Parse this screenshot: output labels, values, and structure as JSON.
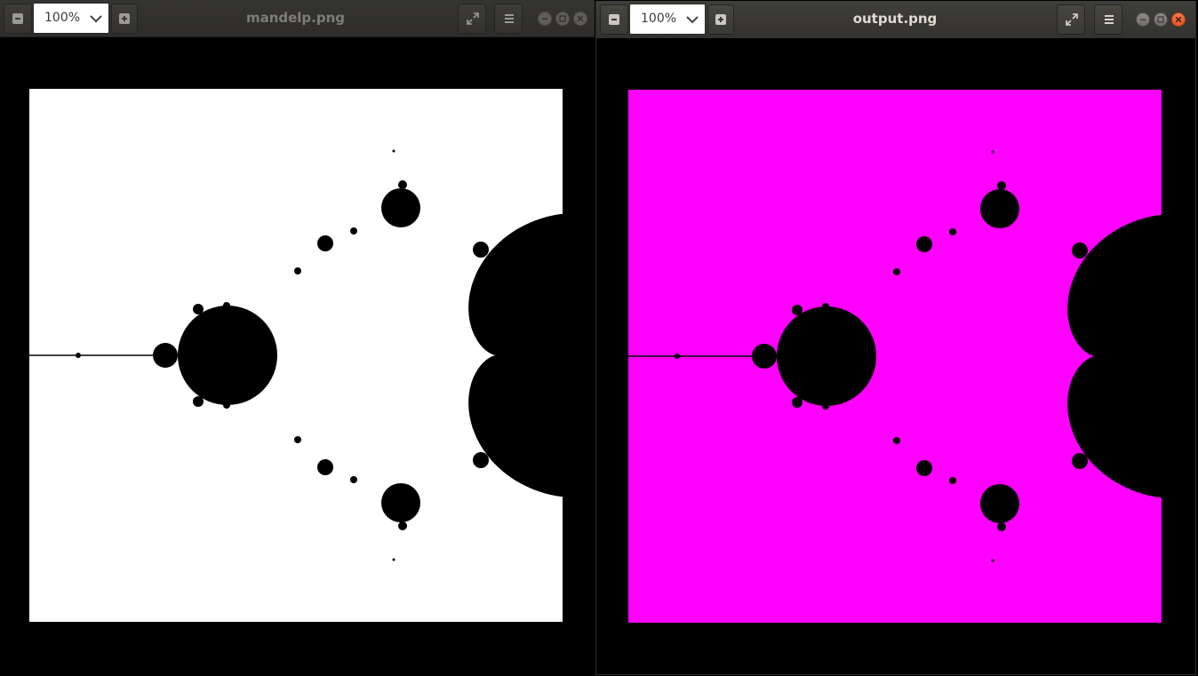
{
  "windows": [
    {
      "title": "mandelp.png",
      "zoom": "100%",
      "background_color": "#ffffff",
      "focused": false
    },
    {
      "title": "output.png",
      "zoom": "100%",
      "background_color": "#ff00ff",
      "focused": true
    }
  ],
  "icons": {
    "zoom_out": "minus-square-icon",
    "zoom_in": "plus-square-icon",
    "zoom_dropdown": "chevron-down-icon",
    "fullscreen": "fullscreen-icon",
    "menu": "hamburger-menu-icon",
    "minimize": "minimize-icon",
    "maximize": "maximize-icon",
    "close": "close-icon"
  },
  "colors": {
    "fractal": "#000000",
    "close_button": "#e95420"
  }
}
